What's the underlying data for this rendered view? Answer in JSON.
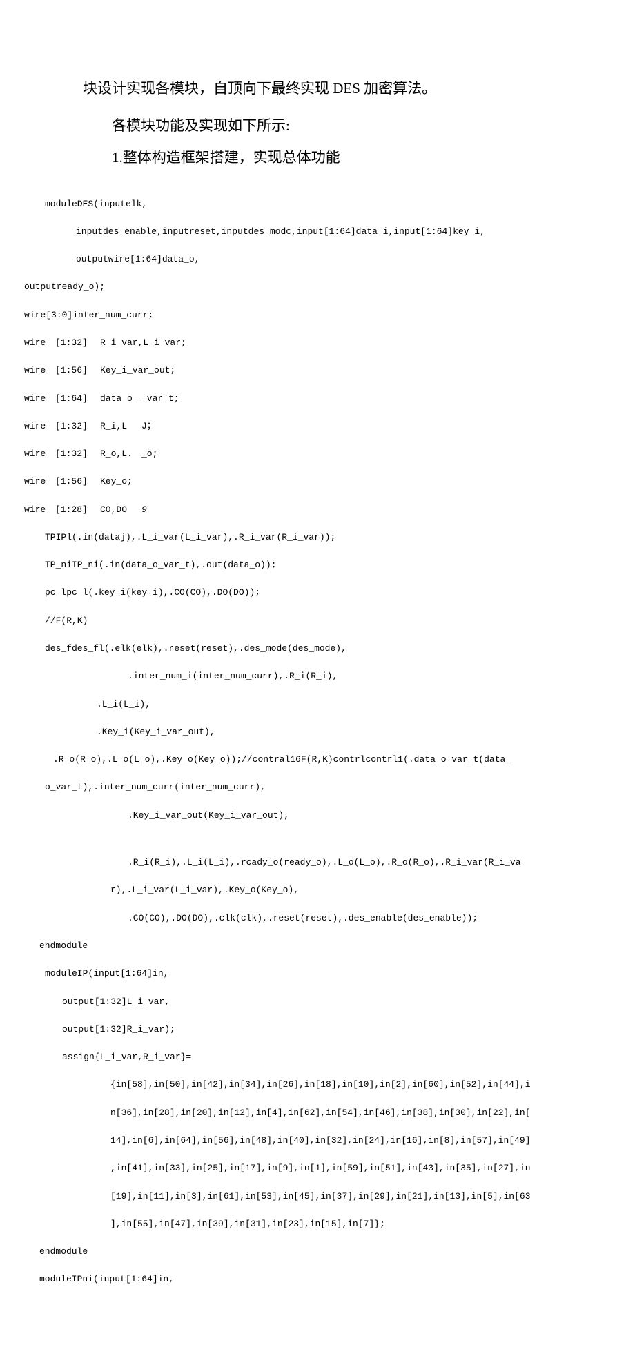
{
  "heading": {
    "line1": "块设计实现各模块，自顶向下最终实现 DES 加密算法。",
    "line2": "各模块功能及实现如下所示:",
    "line3": "1.整体构造框架搭建，实现总体功能"
  },
  "code": {
    "l1": "moduleDES(inputelk,",
    "l2": "inputdes_enable,inputreset,inputdes_modc,input[1:64]data_i,input[1:64]key_i,",
    "l3": "outputwire[1:64]data_o,",
    "l4": "outputready_o);",
    "l5": "wire[3:0]inter_num_curr;",
    "w1a": "wire",
    "w1b": "[1:32]",
    "w1c": "R_i_var,L_i_var;",
    "w2a": "wire",
    "w2b": "[1:56]",
    "w2c": "Key_i_var_out;",
    "w3a": "wire",
    "w3b": "[1:64]",
    "w3c": "data_o_",
    "w3d": "_var_t;",
    "w4a": "wire",
    "w4b": "[1:32]",
    "w4c": "R_i,L",
    "w4d": "J；",
    "w5a": "wire",
    "w5b": "[1:32]",
    "w5c": "R_o,L.",
    "w5d": "_o;",
    "w6a": "wire",
    "w6b": "[1:56]",
    "w6c": "Key_o;",
    "w7a": "wire",
    "w7b": "[1:28]",
    "w7c": "CO,DO",
    "w7d": "9",
    "l13": "TPIPl(.in(dataj),.L_i_var(L_i_var),.R_i_var(R_i_var));",
    "l14": "TP_niIP_ni(.in(data_o_var_t),.out(data_o));",
    "l15": "pc_lpc_l(.key_i(key_i),.CO(CO),.DO(DO));",
    "l16": "//F(R,K)",
    "l17": "des_fdes_fl(.elk(elk),.reset(reset),.des_mode(des_mode),",
    "l18": ".inter_num_i(inter_num_curr),.R_i(R_i),",
    "l19": ".L_i(L_i),",
    "l20": ".Key_i(Key_i_var_out),",
    "l21": ".R_o(R_o),.L_o(L_o),.Key_o(Key_o));//contral16F(R,K)contrlcontrl1(.data_o_var_t(data_",
    "l22": "o_var_t),.inter_num_curr(inter_num_curr),",
    "l23": ".Key_i_var_out(Key_i_var_out),",
    "l24": ".R_i(R_i),.L_i(L_i),.rcady_o(ready_o),.L_o(L_o),.R_o(R_o),.R_i_var(R_i_va",
    "l25": "r),.L_i_var(L_i_var),.Key_o(Key_o),",
    "l26": ".CO(CO),.DO(DO),.clk(clk),.reset(reset),.des_enable(des_enable));",
    "l27": "endmodule",
    "l28": "moduleIP(input[1:64]in,",
    "l29": "output[1:32]L_i_var,",
    "l30": "output[1:32]R_i_var);",
    "l31": "assign{L_i_var,R_i_var}=",
    "l32": "{in[58],in[50],in[42],in[34],in[26],in[18],in[10],in[2],in[60],in[52],in[44],i",
    "l33": "n[36],in[28],in[20],in[12],in[4],in[62],in[54],in[46],in[38],in[30],in[22],in[",
    "l34": "14],in[6],in[64],in[56],in[48],in[40],in[32],in[24],in[16],in[8],in[57],in[49]",
    "l35": ",in[41],in[33],in[25],in[17],in[9],in[1],in[59],in[51],in[43],in[35],in[27],in",
    "l36": "[19],in[11],in[3],in[61],in[53],in[45],in[37],in[29],in[21],in[13],in[5],in[63",
    "l37": "],in[55],in[47],in[39],in[31],in[23],in[15],in[7]};",
    "l38": "endmodule",
    "l39": "moduleIPni(input[1:64]in,"
  }
}
